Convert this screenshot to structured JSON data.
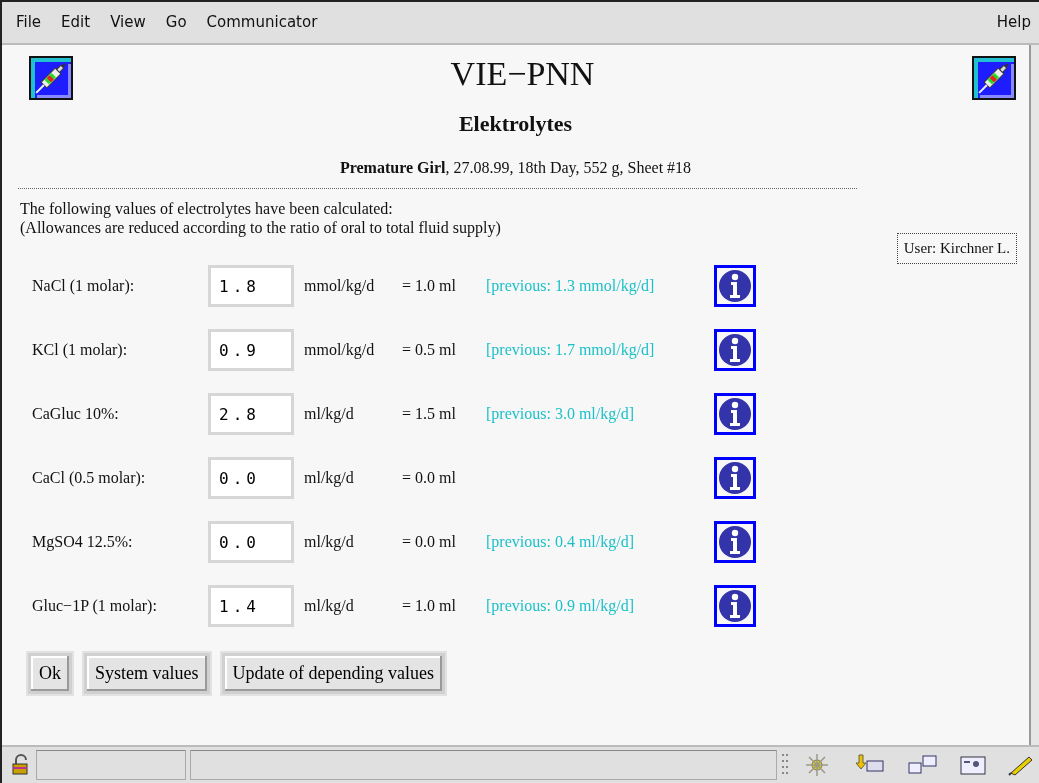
{
  "menu": {
    "items": [
      "File",
      "Edit",
      "View",
      "Go",
      "Communicator"
    ],
    "help": "Help"
  },
  "header": {
    "title": "VIE−PNN",
    "subtitle": "Elektrolytes",
    "patient": "**Premature Girl**, 27.08.99, 18th Day, 552 g, Sheet #18",
    "user": "User: Kirchner L."
  },
  "intro": [
    "The following values of electrolytes have been calculated:",
    "(Allowances are reduced according to the ratio of oral to total fluid supply)"
  ],
  "rows": [
    {
      "label": "NaCl (1 molar):",
      "value": "1.8",
      "unit": "mmol/kg/d",
      "result": "= 1.0 ml",
      "previous": "[previous: 1.3 mmol/kg/d]"
    },
    {
      "label": "KCl (1 molar):",
      "value": "0.9",
      "unit": "mmol/kg/d",
      "result": "= 0.5 ml",
      "previous": "[previous: 1.7 mmol/kg/d]"
    },
    {
      "label": "CaGluc 10%:",
      "value": "2.8",
      "unit": "ml/kg/d",
      "result": "= 1.5 ml",
      "previous": "[previous: 3.0 ml/kg/d]"
    },
    {
      "label": "CaCl (0.5 molar):",
      "value": "0.0",
      "unit": "ml/kg/d",
      "result": "= 0.0 ml"
    },
    {
      "label": "MgSO4 12.5%:",
      "value": "0.0",
      "unit": "ml/kg/d",
      "result": "= 0.0 ml",
      "previous": "[previous: 0.4 ml/kg/d]"
    },
    {
      "label": "Gluc−1P (1 molar):",
      "value": "1.4",
      "unit": "ml/kg/d",
      "result": "= 1.0 ml",
      "previous": "[previous: 0.9 ml/kg/d]"
    }
  ],
  "buttons": [
    "Ok",
    "System values",
    "Update of depending values"
  ]
}
